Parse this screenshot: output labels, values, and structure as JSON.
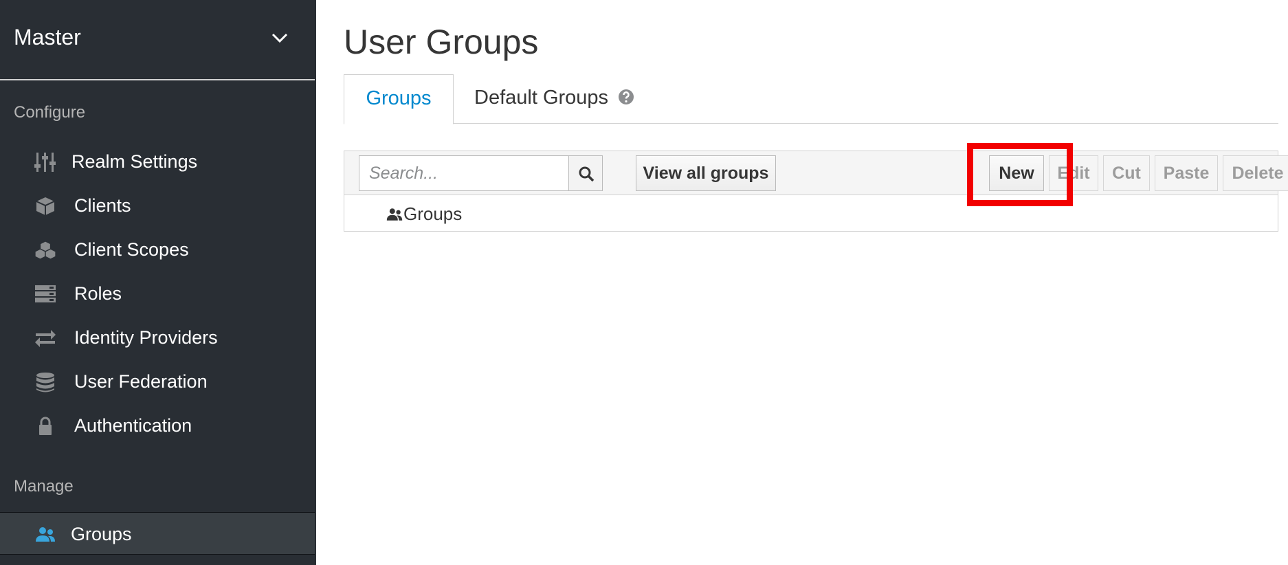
{
  "sidebar": {
    "realm": {
      "name": "Master",
      "chevron_icon": "chevron-down-icon"
    },
    "configure_label": "Configure",
    "manage_label": "Manage",
    "configure_items": [
      {
        "label": "Realm Settings",
        "icon": "sliders-icon"
      },
      {
        "label": "Clients",
        "icon": "cube-icon"
      },
      {
        "label": "Client Scopes",
        "icon": "cubes-icon"
      },
      {
        "label": "Roles",
        "icon": "server-icon"
      },
      {
        "label": "Identity Providers",
        "icon": "exchange-icon"
      },
      {
        "label": "User Federation",
        "icon": "database-icon"
      },
      {
        "label": "Authentication",
        "icon": "lock-icon"
      }
    ],
    "manage_items": [
      {
        "label": "Groups",
        "icon": "users-icon",
        "active": true
      }
    ]
  },
  "main": {
    "title": "User Groups",
    "tabs": [
      {
        "label": "Groups",
        "active": true
      },
      {
        "label": "Default Groups",
        "active": false,
        "icon": "question-circle-icon"
      }
    ],
    "toolbar": {
      "search_placeholder": "Search...",
      "search_icon": "search-icon",
      "view_all_label": "View all groups",
      "new_label": "New",
      "edit_label": "Edit",
      "cut_label": "Cut",
      "paste_label": "Paste",
      "delete_label": "Delete"
    },
    "tree": {
      "root_label": "Groups",
      "root_icon": "users-icon"
    }
  },
  "colors": {
    "sidebar_bg": "#292e34",
    "active_item_bg": "#393f44",
    "accent": "#0088ce",
    "highlight": "#f20000",
    "users_icon": "#39a5dc",
    "nav_icon": "#8b8d8f"
  }
}
